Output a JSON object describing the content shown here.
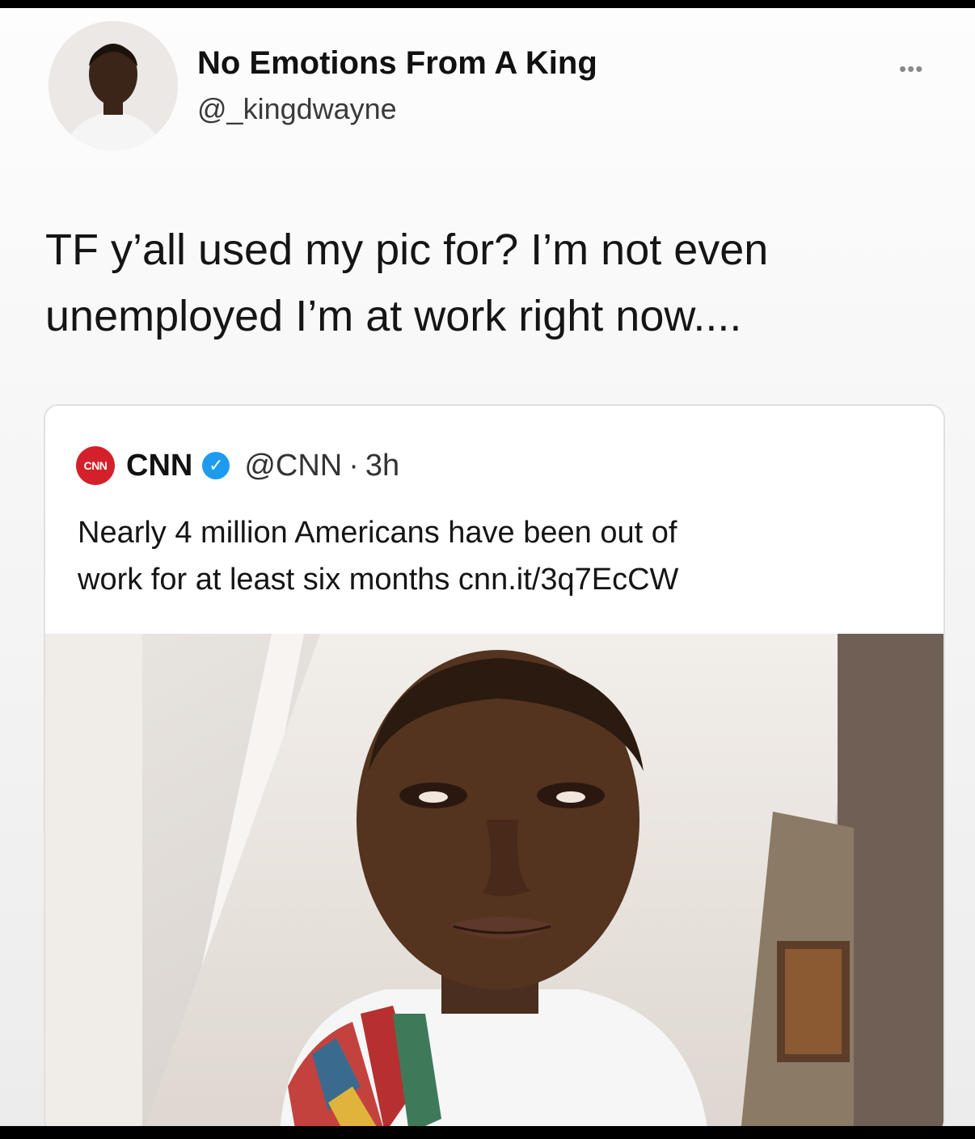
{
  "author": {
    "display_name": "No Emotions From A King",
    "handle": "@_kingdwayne",
    "avatar_icon": "user-avatar-photo",
    "more_icon": "more-options-icon"
  },
  "tweet": {
    "line1": "TF y’all used my pic for? I’m not even",
    "line2": "unemployed I’m at work right now...."
  },
  "quoted_tweet": {
    "logo_text": "CNN",
    "name": "CNN",
    "verified_icon": "verified-badge-icon",
    "verified_color": "#1d9bf0",
    "brand_color": "#d4202a",
    "handle": "@CNN",
    "separator": "·",
    "time": "3h",
    "line1": "Nearly 4 million Americans have been out of",
    "line2": "work for at least six months cnn.it/3q7EcCW",
    "photo_icon": "man-selfie-photo"
  }
}
